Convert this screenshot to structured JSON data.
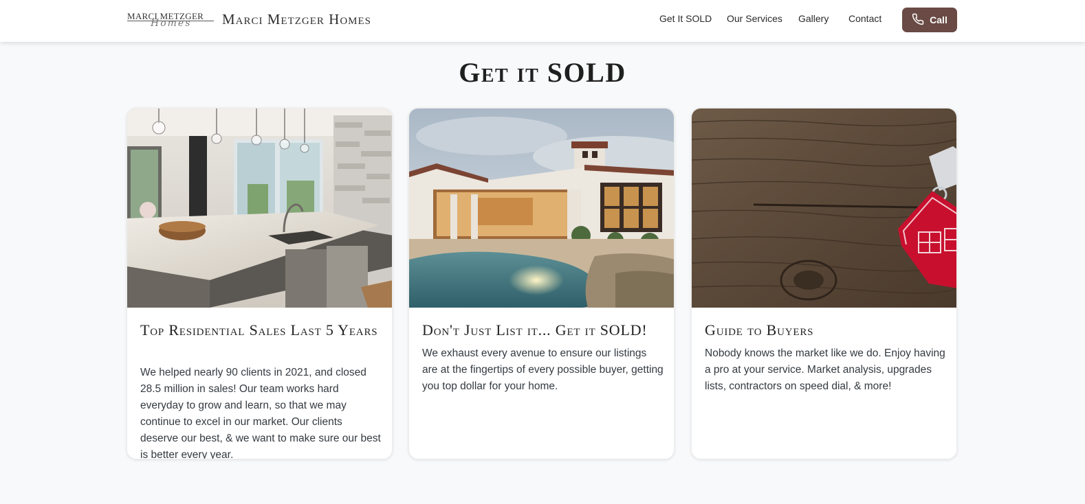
{
  "header": {
    "logo_line1": "MARCI METZGER",
    "logo_line2": "Homes",
    "brand": "Marci Metzger Homes",
    "nav": [
      "Get It SOLD",
      "Our Services",
      "Gallery",
      "Contact"
    ],
    "call_label": "Call"
  },
  "section": {
    "title": "Get it SOLD"
  },
  "cards": [
    {
      "image": "kitchen-photo",
      "title": "Top Residential Sales Last 5 Years",
      "body": "We helped nearly 90 clients in 2021, and closed 28.5 million in sales! Our team works hard everyday to grow and learn, so that we may continue to excel in our market. Our clients deserve our best, & we want to make sure our best is better every year."
    },
    {
      "image": "pool-house-photo",
      "title": "Don't Just List it... Get it SOLD!",
      "body": "We exhaust every avenue to ensure our listings are at the fingertips of every possible buyer, getting you top dollar for your home."
    },
    {
      "image": "house-keychain-photo",
      "title": "Guide to Buyers",
      "body": "Nobody knows the market like we do. Enjoy having a pro at your service. Market analysis, upgrades lists, contractors on speed dial, & more!"
    }
  ],
  "colors": {
    "call_button": "#6a4a44",
    "page_background": "#f8f9fa"
  },
  "icons": [
    "phone-icon"
  ]
}
